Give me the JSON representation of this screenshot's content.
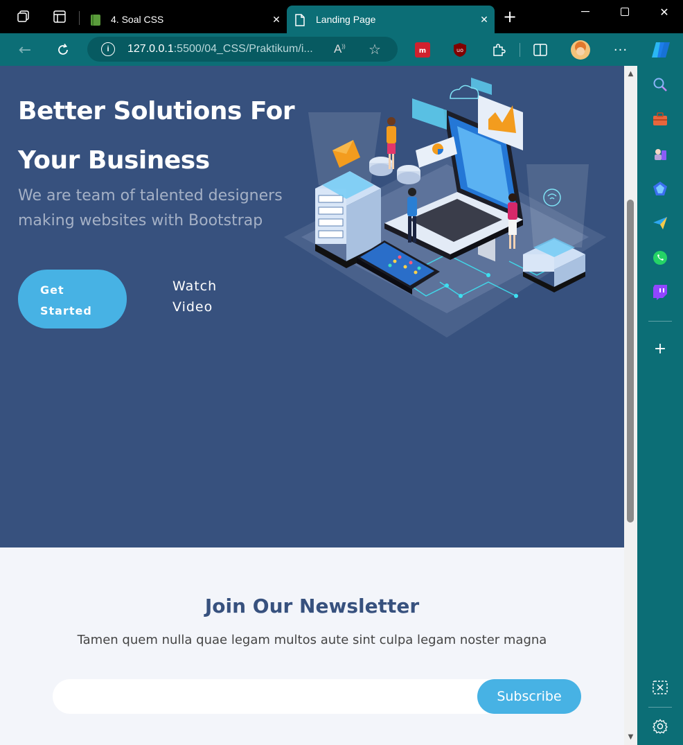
{
  "browser": {
    "tabs": [
      {
        "title": "4. Soal CSS",
        "active": false
      },
      {
        "title": "Landing Page",
        "active": true
      }
    ],
    "url_host": "127.0.0.1",
    "url_path": ":5500/04_CSS/Praktikum/i..."
  },
  "hero": {
    "title_line1": "Better Solutions For",
    "title_line2": "Your Business",
    "subtitle_line1": "We are team of talented designers",
    "subtitle_line2": "making websites with Bootstrap",
    "get_started_line1": "Get",
    "get_started_line2": "Started",
    "watch_line1": "Watch",
    "watch_line2": "Video"
  },
  "newsletter": {
    "title": "Join Our Newsletter",
    "text": "Tamen quem nulla quae legam multos aute sint culpa legam noster magna",
    "input_placeholder": "",
    "button": "Subscribe"
  },
  "colors": {
    "hero_bg": "#37517e",
    "accent": "#47b2e4",
    "browser_teal": "#0c6e76"
  },
  "sidebar_icons": [
    "search-icon",
    "briefcase-icon",
    "chess-icon",
    "copilot-icon",
    "send-icon",
    "whatsapp-icon",
    "twitch-icon",
    "add-icon",
    "screenshot-icon",
    "settings-icon"
  ]
}
